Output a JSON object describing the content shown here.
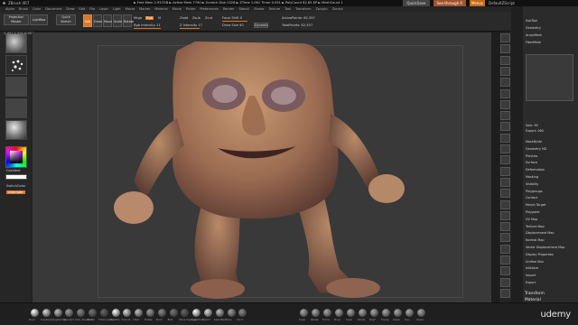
{
  "window": {
    "title": "ZBrush 4R7",
    "info": "► Free Mem 2.957GB ► Active Mem 7790 ► Scratch Disk 0326 ► ZTime 1.061 Timer 0.051 ► PolyCount 62.65 KP ► MeshCount 1",
    "quicksave": "QuickSave",
    "see_through": "See-through 0",
    "menus": "Menus",
    "default_script": "DefaultZScript"
  },
  "menubar": {
    "items": [
      "Alpha",
      "Brush",
      "Color",
      "Document",
      "Draw",
      "Edit",
      "File",
      "Layer",
      "Light",
      "Macro",
      "Marker",
      "Material",
      "Movie",
      "Picker",
      "Preferences",
      "Render",
      "Stencil",
      "Stroke",
      "Texture",
      "Tool",
      "Transform",
      "Zplugin",
      "Zscript"
    ]
  },
  "toolbar": {
    "projection_master": "Projection Master",
    "lightbox": "LightBox",
    "quick_sketch": "Quick Sketch",
    "edit": "Edit",
    "draw": "Draw",
    "move": "Move",
    "scale": "Scale",
    "rotate": "Rotate",
    "mrgb": "Mrgb",
    "rgb": "Rgb",
    "m": "M",
    "rgb_intensity": "Rgb Intensity 11",
    "zadd": "Zadd",
    "zsub": "Zsub",
    "zcut": "Zcut",
    "z_intensity": "Z Intensity 17",
    "focal_shift": "Focal Shift 0",
    "draw_size": "Draw Size 40",
    "dynamic": "Dynamic",
    "active_points": "ActivePoints: 62,557",
    "total_points": "TotalPoints: 62,557"
  },
  "status_coords": "-1.451,1.201,0.007",
  "left_panel": {
    "gradient": "Gradient",
    "switch_color": "SwitchColor",
    "alternate": "Alternate"
  },
  "right_palette": {
    "items_top": [
      "SubTool",
      "Geometry",
      "ArrayMesh",
      "FiberMesh"
    ],
    "mid": [
      "Solo: 60",
      "Export: 060"
    ],
    "items": [
      "MaskByVol",
      "Geometry HD",
      "Preview",
      "Surface",
      "Deformation",
      "Masking",
      "Visibility",
      "Polygroups",
      "Contact",
      "Morph Target",
      "Polypaint",
      "UV Map",
      "Texture Map",
      "Displacement Map",
      "Normal Map",
      "Vector Displacement Map",
      "Display Properties",
      "Unified Skin",
      "Initialize",
      "Import",
      "Export"
    ],
    "bottom": [
      "Transform",
      "Material"
    ]
  },
  "bottom_shelf": {
    "labels": [
      "Move",
      "ClayTubes",
      "ClayBuildup",
      "Standard",
      "Dam_Standard",
      "hPolish",
      "TrimDynamic",
      "MaskPen",
      "Smooth",
      "Inflat",
      "Flatten",
      "Pinch",
      "Blob",
      "Move Topologic",
      "SnakeHook",
      "Slash3",
      "SelectRect",
      "Move",
      "Pinch"
    ],
    "right_labels": [
      "Scale",
      "Rotate",
      "Frame",
      "Move",
      "Scale",
      "Rotate",
      "PolyF",
      "Transp",
      "Ghost",
      "Solo",
      "Xpose"
    ]
  },
  "branding": "udemy",
  "colors": {
    "accent": "#d9782a",
    "panel": "#2b2b2b",
    "viewport": "#393939"
  }
}
